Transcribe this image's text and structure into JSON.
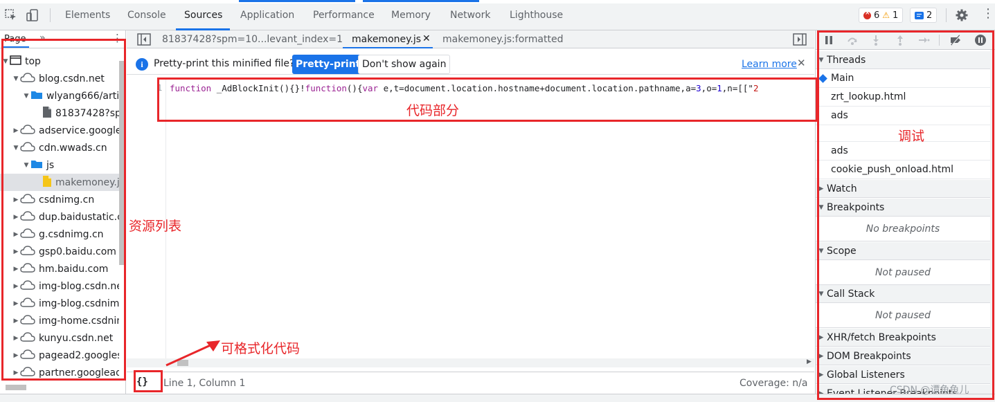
{
  "topbar": {
    "tabs": [
      {
        "label": "Elements",
        "active": false
      },
      {
        "label": "Console",
        "active": false
      },
      {
        "label": "Sources",
        "active": true
      },
      {
        "label": "Application",
        "active": false
      },
      {
        "label": "Performance",
        "active": false
      },
      {
        "label": "Memory",
        "active": false
      },
      {
        "label": "Network",
        "active": false
      },
      {
        "label": "Lighthouse",
        "active": false
      }
    ],
    "errors": "6",
    "warnings": "1",
    "messages": "2",
    "accent": "#1a73e8"
  },
  "navigator": {
    "tab_label": "Page",
    "more_label": "»",
    "tree": [
      {
        "label": "top",
        "icon": "frame-icon",
        "depth": 0,
        "expanded": true
      },
      {
        "label": "blog.csdn.net",
        "icon": "cloud-icon",
        "depth": 1,
        "expanded": true
      },
      {
        "label": "wlyang666/artic",
        "icon": "folder-icon",
        "depth": 2,
        "expanded": true
      },
      {
        "label": "81837428?sp",
        "icon": "file-icon",
        "depth": 3,
        "expanded": null
      },
      {
        "label": "adservice.google.",
        "icon": "cloud-icon",
        "depth": 1,
        "expanded": false
      },
      {
        "label": "cdn.wwads.cn",
        "icon": "cloud-icon",
        "depth": 1,
        "expanded": true
      },
      {
        "label": "js",
        "icon": "folder-icon",
        "depth": 2,
        "expanded": true
      },
      {
        "label": "makemoney.j",
        "icon": "js-file-icon",
        "depth": 3,
        "expanded": null,
        "selected": true
      },
      {
        "label": "csdnimg.cn",
        "icon": "cloud-icon",
        "depth": 1,
        "expanded": false
      },
      {
        "label": "dup.baidustatic.co",
        "icon": "cloud-icon",
        "depth": 1,
        "expanded": false
      },
      {
        "label": "g.csdnimg.cn",
        "icon": "cloud-icon",
        "depth": 1,
        "expanded": false
      },
      {
        "label": "gsp0.baidu.com",
        "icon": "cloud-icon",
        "depth": 1,
        "expanded": false
      },
      {
        "label": "hm.baidu.com",
        "icon": "cloud-icon",
        "depth": 1,
        "expanded": false
      },
      {
        "label": "img-blog.csdn.ne",
        "icon": "cloud-icon",
        "depth": 1,
        "expanded": false
      },
      {
        "label": "img-blog.csdnimg",
        "icon": "cloud-icon",
        "depth": 1,
        "expanded": false
      },
      {
        "label": "img-home.csdnim",
        "icon": "cloud-icon",
        "depth": 1,
        "expanded": false
      },
      {
        "label": "kunyu.csdn.net",
        "icon": "cloud-icon",
        "depth": 1,
        "expanded": false
      },
      {
        "label": "pagead2.googles",
        "icon": "cloud-icon",
        "depth": 1,
        "expanded": false
      },
      {
        "label": "partner.googlead",
        "icon": "cloud-icon",
        "depth": 1,
        "expanded": false
      }
    ]
  },
  "editor": {
    "tabs": [
      {
        "label": "81837428?spm=10...levant_index=1",
        "active": false,
        "closable": false
      },
      {
        "label": "makemoney.js",
        "active": true,
        "closable": true
      },
      {
        "label": "makemoney.js:formatted",
        "active": false,
        "closable": false
      }
    ],
    "info_bar": {
      "text": "Pretty-print this minified file?",
      "primary_button": "Pretty-print",
      "secondary_button": "Don't show again",
      "link": "Learn more",
      "close": "✕"
    },
    "line_number": "1",
    "code_tokens": [
      {
        "t": "function",
        "c": "kw"
      },
      {
        "t": " _AdBlockInit(){}!",
        "c": "fn"
      },
      {
        "t": "function",
        "c": "kw"
      },
      {
        "t": "(){",
        "c": "fn"
      },
      {
        "t": "var",
        "c": "kw"
      },
      {
        "t": " e,t=document.location.hostname+document.location.pathname,a=",
        "c": "fn"
      },
      {
        "t": "3",
        "c": "num"
      },
      {
        "t": ",o=",
        "c": "fn"
      },
      {
        "t": "1",
        "c": "num"
      },
      {
        "t": ",n=[[\"",
        "c": "fn"
      },
      {
        "t": "2",
        "c": "str"
      }
    ],
    "format_button": "{}",
    "status_position": "Line 1, Column 1",
    "status_coverage": "Coverage: n/a"
  },
  "debugger": {
    "sections": {
      "threads": "Threads",
      "watch": "Watch",
      "breakpoints": "Breakpoints",
      "breakpoints_empty": "No breakpoints",
      "scope": "Scope",
      "scope_empty": "Not paused",
      "callstack": "Call Stack",
      "callstack_empty": "Not paused",
      "xhr": "XHR/fetch Breakpoints",
      "dom": "DOM Breakpoints",
      "global": "Global Listeners",
      "event": "Event Listener Breakpoints"
    },
    "threads": [
      {
        "label": "Main",
        "current": true
      },
      {
        "label": "zrt_lookup.html",
        "current": false
      },
      {
        "label": "ads",
        "current": false
      },
      {
        "label": "",
        "current": false
      },
      {
        "label": "ads",
        "current": false
      },
      {
        "label": "cookie_push_onload.html",
        "current": false
      }
    ]
  },
  "annotations": {
    "code_label": "代码部分",
    "debug_label": "调试",
    "resources_label": "资源列表",
    "format_label": "可格式化代码",
    "color": "#e8262a"
  },
  "watermark": "CSDN @谭鱼鱼儿"
}
